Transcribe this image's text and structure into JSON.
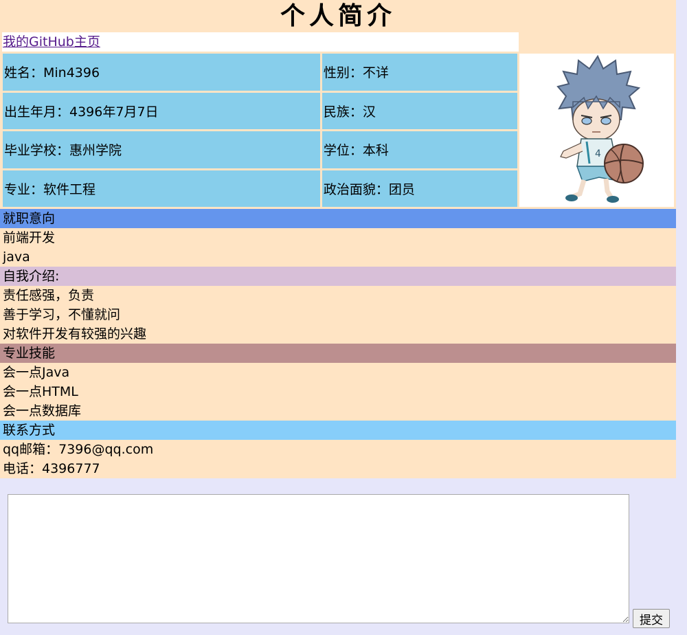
{
  "header": {
    "title": "个人简介"
  },
  "github_link": {
    "text": "我的GitHub主页"
  },
  "info": {
    "name": "姓名：Min4396",
    "gender": "性别：不详",
    "birth": "出生年月：4396年7月7日",
    "ethnicity": "民族：汉",
    "school": "毕业学校：惠州学院",
    "degree": "学位：本科",
    "major": "专业：软件工程",
    "politics": "政治面貌：团员",
    "photo_icon": "anime-basketball-avatar"
  },
  "sections": {
    "job": {
      "heading": "就职意向",
      "items": [
        "前端开发",
        "java"
      ]
    },
    "self": {
      "heading": "自我介绍:",
      "items": [
        "责任感强，负责",
        "善于学习，不懂就问",
        "对软件开发有较强的兴趣"
      ]
    },
    "skills": {
      "heading": "专业技能",
      "items": [
        "会一点Java",
        "会一点HTML",
        "会一点数据库"
      ]
    },
    "contact": {
      "heading": "联系方式",
      "items": [
        "qq邮箱：7396@qq.com",
        "电话：4396777"
      ]
    }
  },
  "form": {
    "textarea_value": "",
    "submit_label": "提交"
  },
  "colors": {
    "page_bg": "#e6e6fa",
    "content_bg": "#ffe4c4",
    "table_cell": "#87ceeb",
    "job_header": "#6495ed",
    "self_header": "#d8bfd8",
    "skills_header": "#bc8f8f",
    "contact_header": "#87cefa",
    "link": "#551a8b"
  }
}
